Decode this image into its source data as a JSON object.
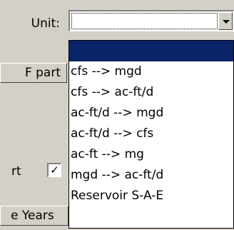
{
  "unit_label": "Unit:",
  "combo": {
    "value": "",
    "arrow_icon": "chevron-down-icon"
  },
  "left": {
    "f_part_label": "F part",
    "rt_label": "rt",
    "checkbox_checked": true,
    "checkbox_glyph": "✓",
    "years_label": "e Years"
  },
  "dropdown": {
    "options": [
      {
        "label": "",
        "selected": true
      },
      {
        "label": "cfs --> mgd",
        "selected": false
      },
      {
        "label": "cfs --> ac-ft/d",
        "selected": false
      },
      {
        "label": "ac-ft/d --> mgd",
        "selected": false
      },
      {
        "label": "ac-ft/d --> cfs",
        "selected": false
      },
      {
        "label": "ac-ft --> mg",
        "selected": false
      },
      {
        "label": "mgd --> ac-ft/d",
        "selected": false
      },
      {
        "label": "Reservoir S-A-E",
        "selected": false
      }
    ]
  },
  "colors": {
    "selection": "#0a246a",
    "face": "#d4d0c8"
  }
}
